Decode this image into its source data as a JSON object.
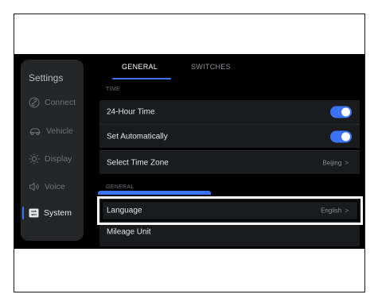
{
  "sidebar": {
    "title": "Settings",
    "items": [
      {
        "label": "Connect",
        "icon": "link-icon"
      },
      {
        "label": "Vehicle",
        "icon": "car-icon"
      },
      {
        "label": "Display",
        "icon": "sun-icon"
      },
      {
        "label": "Voice",
        "icon": "speaker-icon"
      },
      {
        "label": "System",
        "icon": "system-icon"
      }
    ],
    "active": "System"
  },
  "tabs": [
    {
      "label": "GENERAL",
      "active": true
    },
    {
      "label": "SWITCHES",
      "active": false
    }
  ],
  "sections": {
    "time": "TIME",
    "general": "GENERAL"
  },
  "rows": {
    "hour24": {
      "label": "24-Hour Time",
      "on": true
    },
    "set_auto": {
      "label": "Set Automatically",
      "on": true
    },
    "timezone": {
      "label": "Select Time Zone",
      "value": "Beijing"
    },
    "language": {
      "label": "Language",
      "value": "English"
    },
    "mileage": {
      "label": "Mileage Unit"
    }
  },
  "colors": {
    "accent": "#3b73f6",
    "background": "#000000",
    "panel": "#1a1b1d",
    "highlight": "#ffffff"
  }
}
